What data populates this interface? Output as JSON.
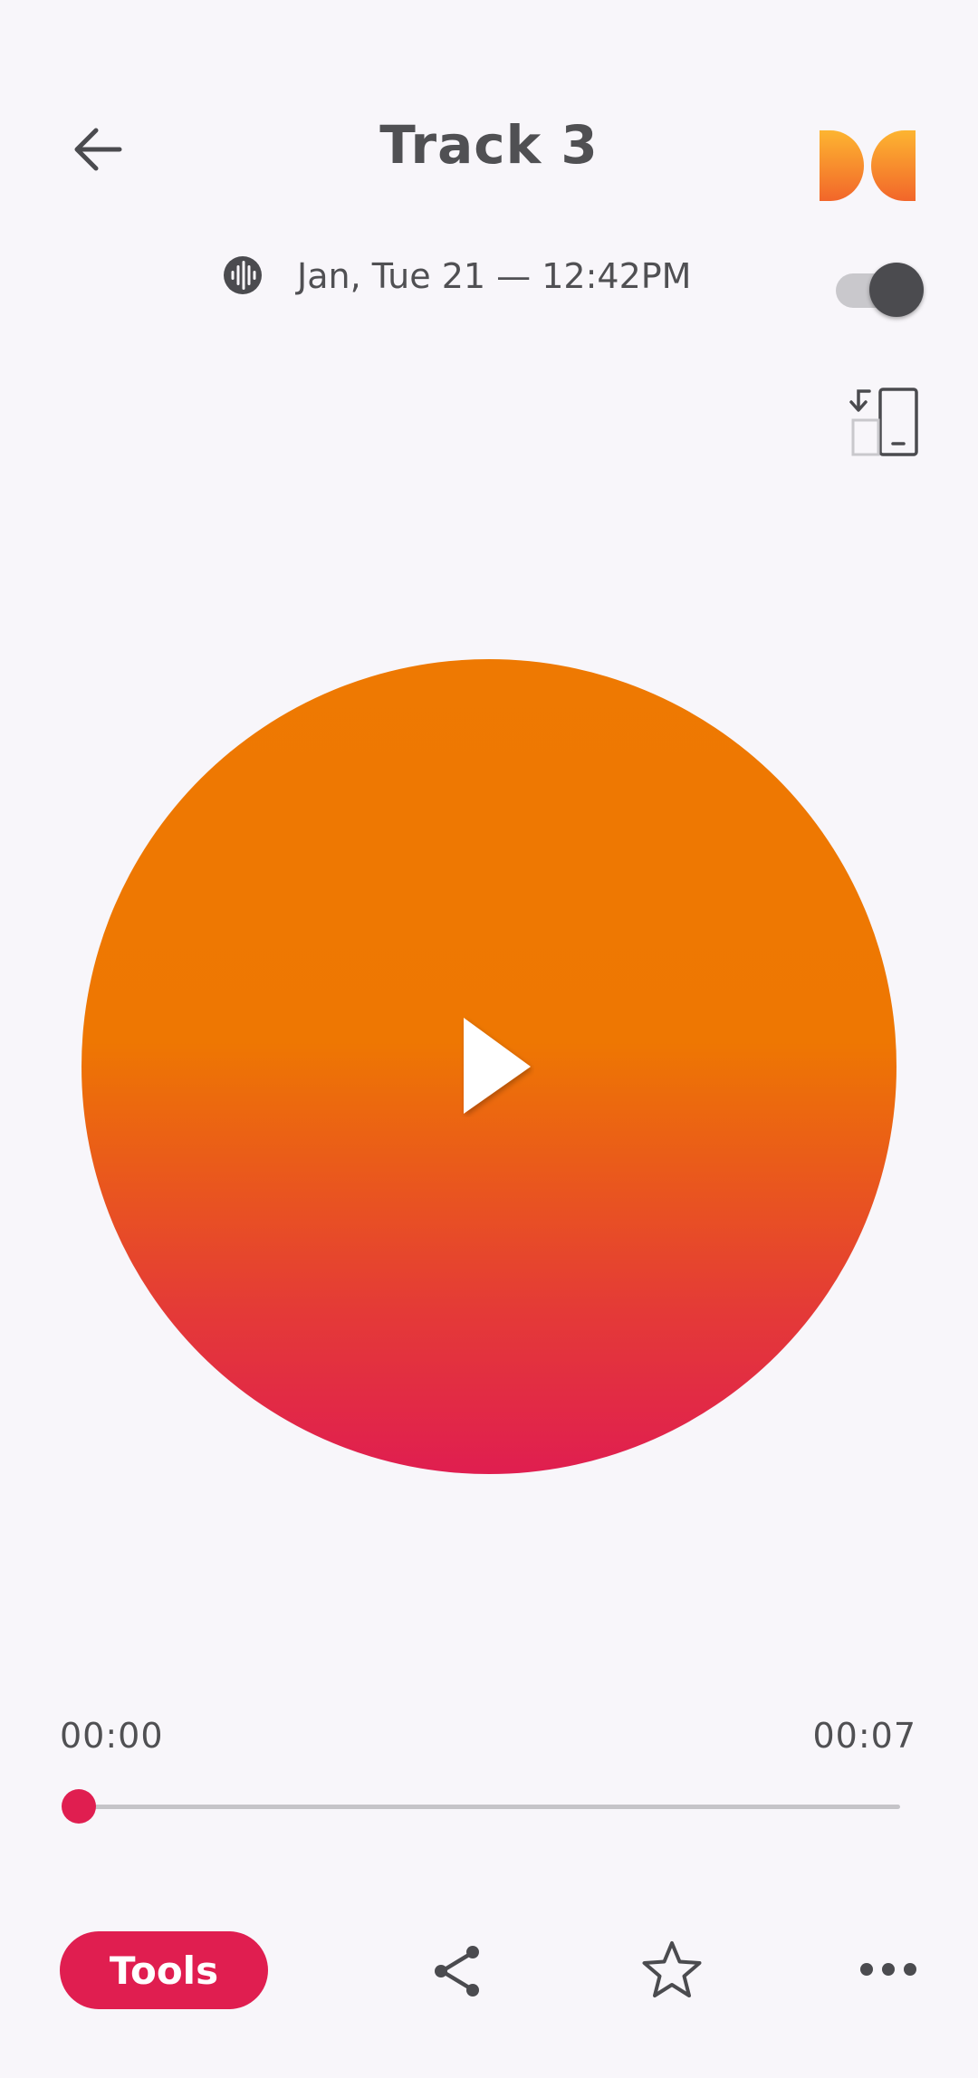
{
  "header": {
    "title": "Track 3",
    "back_icon": "arrow-left-icon",
    "logo_icon": "dolby-logo-icon"
  },
  "meta": {
    "waveform_icon": "waveform-icon",
    "datetime": "Jan, Tue 21 — 12:42PM",
    "toggle_on": true
  },
  "player": {
    "rotate_icon": "screen-rotate-icon",
    "play_icon": "play-icon",
    "current_time": "00:00",
    "total_time": "00:07",
    "progress": 0.0
  },
  "bottom_bar": {
    "tools_label": "Tools",
    "share_icon": "share-icon",
    "favorite_icon": "star-icon",
    "more_icon": "more-horizontal-icon"
  },
  "colors": {
    "accent": "#e01e50",
    "artwork_top": "#ee7902",
    "artwork_bottom": "#e01e50",
    "logo_top": "#fdb531",
    "logo_bottom": "#f2662a",
    "icon": "#4b4b4f",
    "background": "#f8f6fa"
  }
}
